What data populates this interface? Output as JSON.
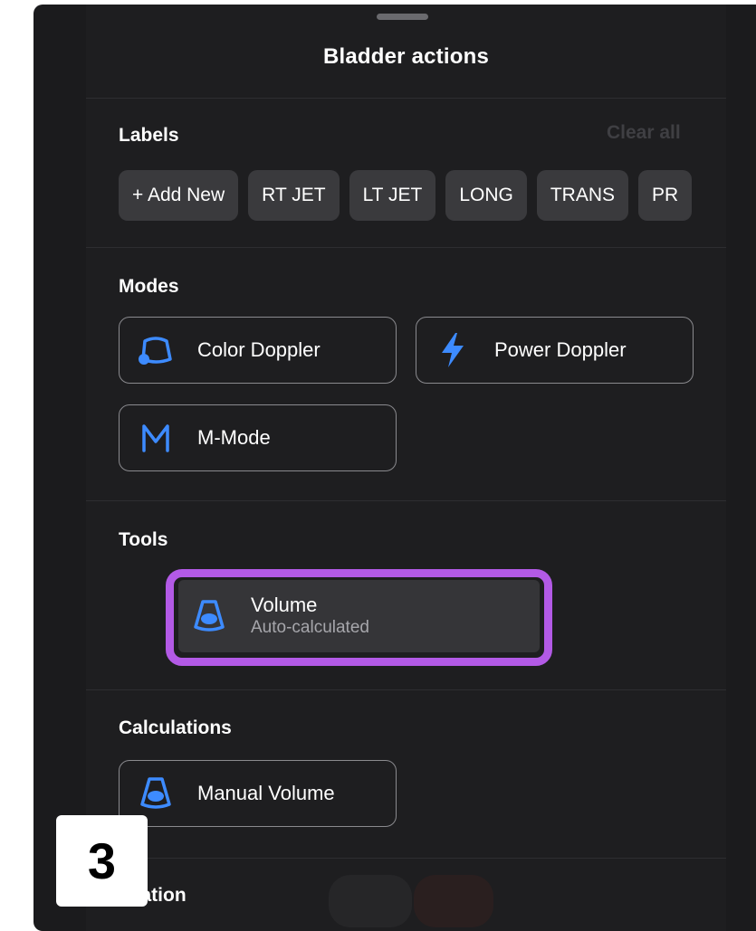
{
  "sheet": {
    "title": "Bladder actions"
  },
  "labels": {
    "heading": "Labels",
    "clear_all": "Clear all",
    "chips": [
      "+ Add New",
      "RT JET",
      "LT JET",
      "LONG",
      "TRANS",
      "PR"
    ]
  },
  "modes": {
    "heading": "Modes",
    "color_doppler": "Color Doppler",
    "power_doppler": "Power Doppler",
    "m_mode": "M-Mode"
  },
  "tools": {
    "heading": "Tools",
    "volume": {
      "label": "Volume",
      "sublabel": "Auto-calculated"
    }
  },
  "calculations": {
    "heading": "Calculations",
    "manual_volume": "Manual Volume"
  },
  "education": {
    "heading": "ucation"
  },
  "step_badge": "3",
  "colors": {
    "accent_blue": "#3d8bff",
    "highlight_purple": "#b35ae6",
    "sheet_background": "#1e1e20"
  }
}
